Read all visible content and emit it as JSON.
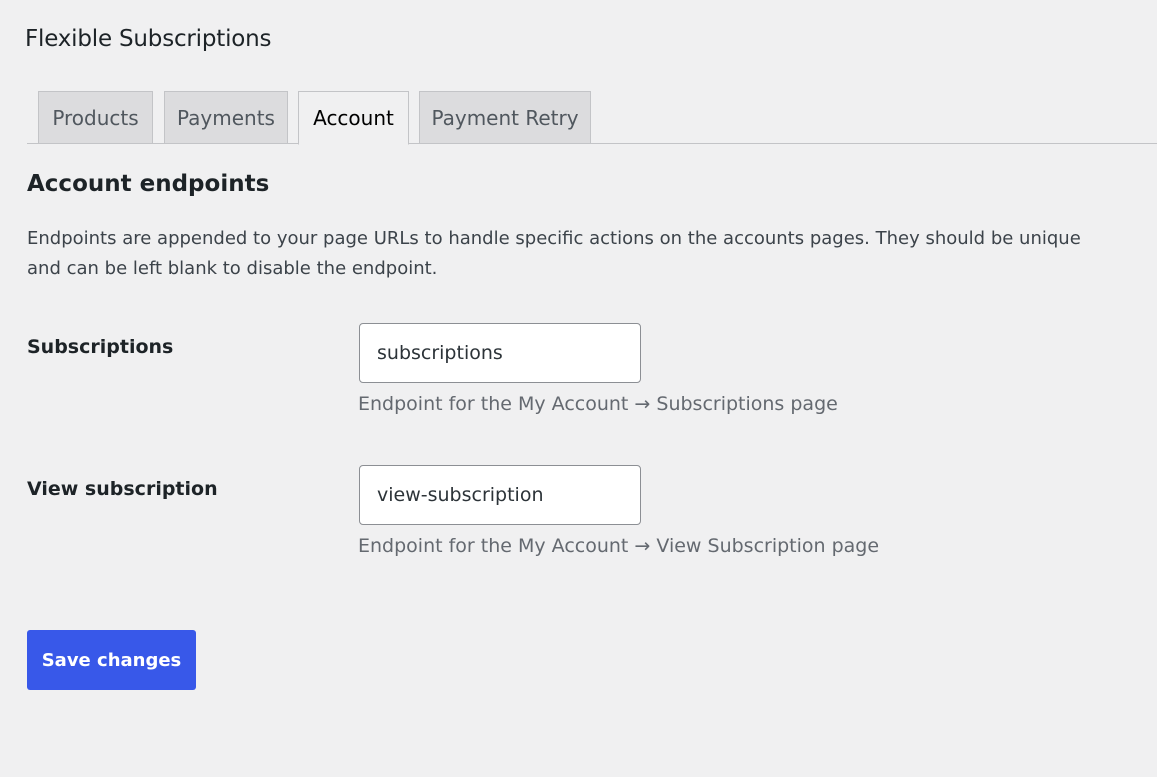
{
  "page": {
    "title": "Flexible Subscriptions"
  },
  "tabs": [
    {
      "label": "Products",
      "active": false
    },
    {
      "label": "Payments",
      "active": false
    },
    {
      "label": "Account",
      "active": true
    },
    {
      "label": "Payment Retry",
      "active": false
    }
  ],
  "section": {
    "title": "Account endpoints",
    "description": "Endpoints are appended to your page URLs to handle specific actions on the accounts pages. They should be unique and can be left blank to disable the endpoint."
  },
  "fields": [
    {
      "label": "Subscriptions",
      "value": "subscriptions",
      "help": "Endpoint for the My Account → Subscriptions page"
    },
    {
      "label": "View subscription",
      "value": "view-subscription",
      "help": "Endpoint for the My Account → View Subscription page"
    }
  ],
  "actions": {
    "save_label": "Save changes"
  },
  "colors": {
    "background": "#f0f0f1",
    "primary_button": "#3858e9",
    "tab_inactive": "#dcdcde",
    "help_text": "#646970"
  }
}
